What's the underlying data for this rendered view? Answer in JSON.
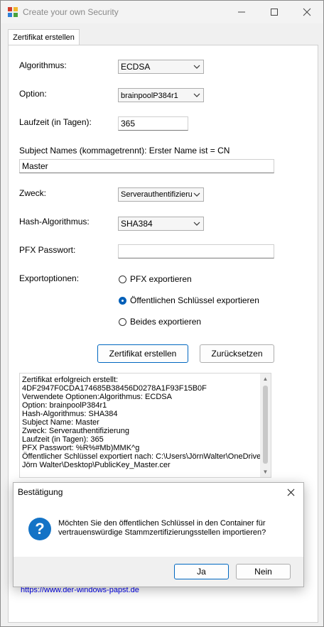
{
  "window": {
    "title": "Create your own Security"
  },
  "tabs": [
    {
      "label": "Zertifikat erstellen"
    }
  ],
  "form": {
    "algorithm": {
      "label": "Algorithmus:",
      "value": "ECDSA"
    },
    "option": {
      "label": "Option:",
      "value": "brainpoolP384r1"
    },
    "validity": {
      "label": "Laufzeit (in Tagen):",
      "value": "365"
    },
    "subject_names": {
      "label": "Subject Names (kommagetrennt): Erster Name ist = CN",
      "value": "Master"
    },
    "purpose": {
      "label": "Zweck:",
      "value": "Serverauthentifizierung"
    },
    "hash": {
      "label": "Hash-Algorithmus:",
      "value": "SHA384"
    },
    "pfx_password": {
      "label": "PFX Passwort:",
      "value": ""
    },
    "export": {
      "label": "Exportoptionen:",
      "options": [
        {
          "label": "PFX exportieren",
          "selected": false
        },
        {
          "label": "Öffentlichen Schlüssel exportieren",
          "selected": true
        },
        {
          "label": "Beides exportieren",
          "selected": false
        }
      ]
    },
    "create_button": "Zertifikat erstellen",
    "reset_button": "Zurücksetzen"
  },
  "output": {
    "lines": [
      "Zertifikat erfolgreich erstellt:",
      "4DF2947F0CDA174685B38456D0278A1F93F15B0F",
      "Verwendete Optionen:Algorithmus: ECDSA",
      "Option: brainpoolP384r1",
      "Hash-Algorithmus: SHA384",
      "Subject Name: Master",
      "Zweck: Serverauthentifizierung",
      "Laufzeit (in Tagen): 365",
      "PFX Passwort: %R%#Mb)MMK^g",
      "Öffentlicher Schlüssel exportiert nach: C:\\Users\\JörnWalter\\OneDrive -",
      "Jörn Walter\\Desktop\\PublicKey_Master.cer"
    ]
  },
  "link": "https://www.der-windows-papst.de",
  "dialog": {
    "title": "Bestätigung",
    "message_line1": "Möchten Sie den öffentlichen Schlüssel in den Container für",
    "message_line2": "vertrauenswürdige Stammzertifizierungsstellen importieren?",
    "yes_button": "Ja",
    "no_button": "Nein"
  },
  "colors": {
    "accent": "#005fb8",
    "dialog_icon": "#1473c6",
    "link": "#0000ee"
  },
  "icons": [
    "app-icon",
    "minimize-icon",
    "maximize-icon",
    "close-icon",
    "chevron-down-icon",
    "question-icon"
  ]
}
